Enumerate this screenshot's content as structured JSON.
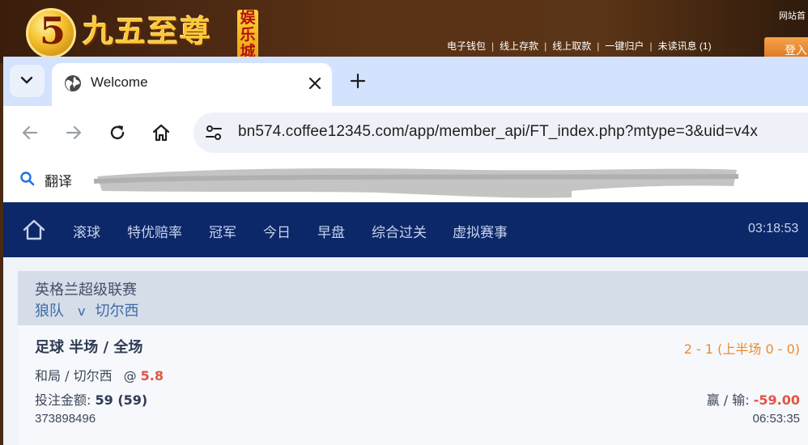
{
  "site": {
    "logo_digit": "5",
    "logo_text": "九五至尊",
    "logo_badge": "娱乐城",
    "links": [
      "电子钱包",
      "线上存款",
      "线上取款",
      "一键归户",
      "未读讯息 (1)"
    ],
    "link_separator": "|",
    "corner_text": "网站首",
    "login_label": "登入",
    "colors": {
      "gold": "#f9c93a",
      "login": "#e3862f"
    }
  },
  "browser": {
    "tab_title": "Welcome",
    "url": "bn574.coffee12345.com/app/member_api/FT_index.php?mtype=3&uid=v4x",
    "bookmark_label": "翻译",
    "icons": [
      "tab-search-icon",
      "globe-icon",
      "close-icon",
      "plus-icon",
      "back-icon",
      "forward-icon",
      "reload-icon",
      "home-icon",
      "tune-icon",
      "search-icon"
    ]
  },
  "nav": {
    "items": [
      "滚球",
      "特优赔率",
      "冠军",
      "今日",
      "早盘",
      "综合过关",
      "虚拟赛事"
    ],
    "clock": "03:18:53",
    "colors": {
      "bar": "#0c2868",
      "text": "#c7d3ee"
    }
  },
  "bet": {
    "league": "英格兰超级联赛",
    "home_team": "狼队",
    "vs": "v",
    "away_team": "切尔西",
    "bet_type": "足球 半场 / 全场",
    "score": "2 - 1 (上半场 0 - 0)",
    "selection": "和局 / 切尔西",
    "at": "@",
    "odds": "5.8",
    "stake_label": "投注金额:",
    "stake_value": "59 (59)",
    "winloss_label": "赢 / 输:",
    "winloss_value": "-59.00",
    "ticket_id": "373898496",
    "time": "06:53:35",
    "colors": {
      "score": "#f0892a",
      "negative": "#e05544",
      "team": "#3f6aa8"
    }
  }
}
